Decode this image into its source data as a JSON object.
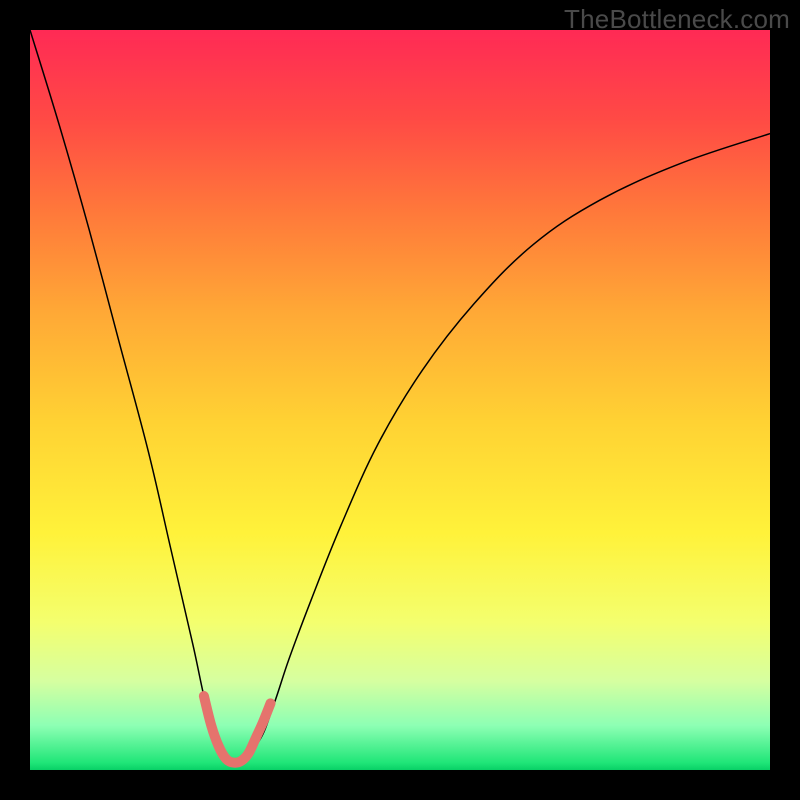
{
  "watermark": "TheBottleneck.com",
  "chart_data": {
    "type": "line",
    "title": "",
    "xlabel": "",
    "ylabel": "",
    "xlim": [
      0,
      100
    ],
    "ylim": [
      0,
      100
    ],
    "grid": false,
    "legend": false,
    "background_gradient": {
      "direction": "vertical",
      "stops": [
        {
          "pos": 0,
          "color": "#ff2a55"
        },
        {
          "pos": 25,
          "color": "#ff7a3a"
        },
        {
          "pos": 53,
          "color": "#ffd233"
        },
        {
          "pos": 80,
          "color": "#f4ff6e"
        },
        {
          "pos": 94,
          "color": "#8dffb4"
        },
        {
          "pos": 100,
          "color": "#08d066"
        }
      ]
    },
    "series": [
      {
        "name": "bottleneck-curve",
        "color": "#000000",
        "stroke_width": 1.5,
        "x": [
          0,
          4,
          8,
          12,
          16,
          19,
          22,
          24,
          26,
          27,
          28,
          31,
          33,
          35,
          38,
          42,
          47,
          53,
          60,
          68,
          77,
          88,
          100
        ],
        "values": [
          100,
          87,
          73,
          58,
          43,
          30,
          17,
          8,
          3,
          1,
          1,
          4,
          9,
          15,
          23,
          33,
          44,
          54,
          63,
          71,
          77,
          82,
          86
        ]
      },
      {
        "name": "highlight-segment",
        "color": "#e5736d",
        "stroke_width": 10,
        "linecap": "round",
        "x": [
          23.5,
          24.5,
          25.5,
          26.5,
          27.5,
          28.5,
          29.5,
          30.5,
          31.5,
          32.5
        ],
        "values": [
          10,
          6,
          3.2,
          1.5,
          1.0,
          1.2,
          2.2,
          4.3,
          6.5,
          9.0
        ]
      }
    ],
    "annotations": []
  }
}
